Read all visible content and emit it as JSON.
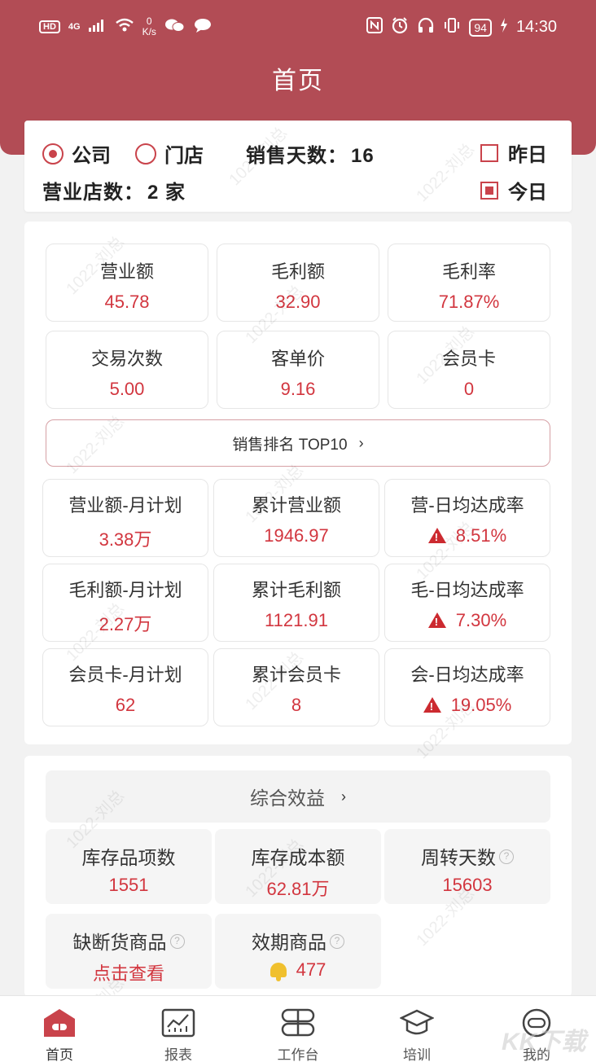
{
  "status_bar": {
    "left": {
      "hd": "HD",
      "network": "4G",
      "speed_value": "0",
      "speed_unit": "K/s"
    },
    "right": {
      "battery": "94",
      "time": "14:30"
    }
  },
  "header": {
    "title": "首页"
  },
  "filter": {
    "radio_company": "公司",
    "radio_store": "门店",
    "sales_days_label": "销售天数：",
    "sales_days_value": "16",
    "stores_label": "营业店数：",
    "stores_value": "2 家",
    "yesterday": "昨日",
    "today": "今日"
  },
  "metrics": [
    {
      "label": "营业额",
      "value": "45.78"
    },
    {
      "label": "毛利额",
      "value": "32.90"
    },
    {
      "label": "毛利率",
      "value": "71.87%"
    },
    {
      "label": "交易次数",
      "value": "5.00"
    },
    {
      "label": "客单价",
      "value": "9.16"
    },
    {
      "label": "会员卡",
      "value": "0"
    }
  ],
  "rank_button": {
    "label": "销售排名 TOP10",
    "chevron": "›"
  },
  "plans": [
    {
      "label": "营业额-月计划",
      "value": "3.38万"
    },
    {
      "label": "累计营业额",
      "value": "1946.97"
    },
    {
      "label": "营-日均达成率",
      "value": "8.51%"
    },
    {
      "label": "毛利额-月计划",
      "value": "2.27万"
    },
    {
      "label": "累计毛利额",
      "value": "1121.91"
    },
    {
      "label": "毛-日均达成率",
      "value": "7.30%"
    },
    {
      "label": "会员卡-月计划",
      "value": "62"
    },
    {
      "label": "累计会员卡",
      "value": "8"
    },
    {
      "label": "会-日均达成率",
      "value": "19.05%"
    }
  ],
  "benefit": {
    "header": "综合效益",
    "chevron": "›",
    "items": [
      {
        "label": "库存品项数",
        "value": "1551"
      },
      {
        "label": "库存成本额",
        "value": "62.81万"
      },
      {
        "label": "周转天数",
        "value": "15603"
      },
      {
        "label": "缺断货商品",
        "value": "点击查看"
      },
      {
        "label": "效期商品",
        "value": "477"
      }
    ],
    "help_glyph": "?"
  },
  "watermark": "1022-刘总",
  "brand_mark": "KK下载",
  "tabs": [
    {
      "label": "首页",
      "icon": "home-icon"
    },
    {
      "label": "报表",
      "icon": "report-chart-icon"
    },
    {
      "label": "工作台",
      "icon": "workbench-icon"
    },
    {
      "label": "培训",
      "icon": "graduation-cap-icon"
    },
    {
      "label": "我的",
      "icon": "profile-icon"
    }
  ],
  "colors": {
    "header": "#b24c55",
    "accent": "#c9434b",
    "value_red": "#d2363f"
  }
}
